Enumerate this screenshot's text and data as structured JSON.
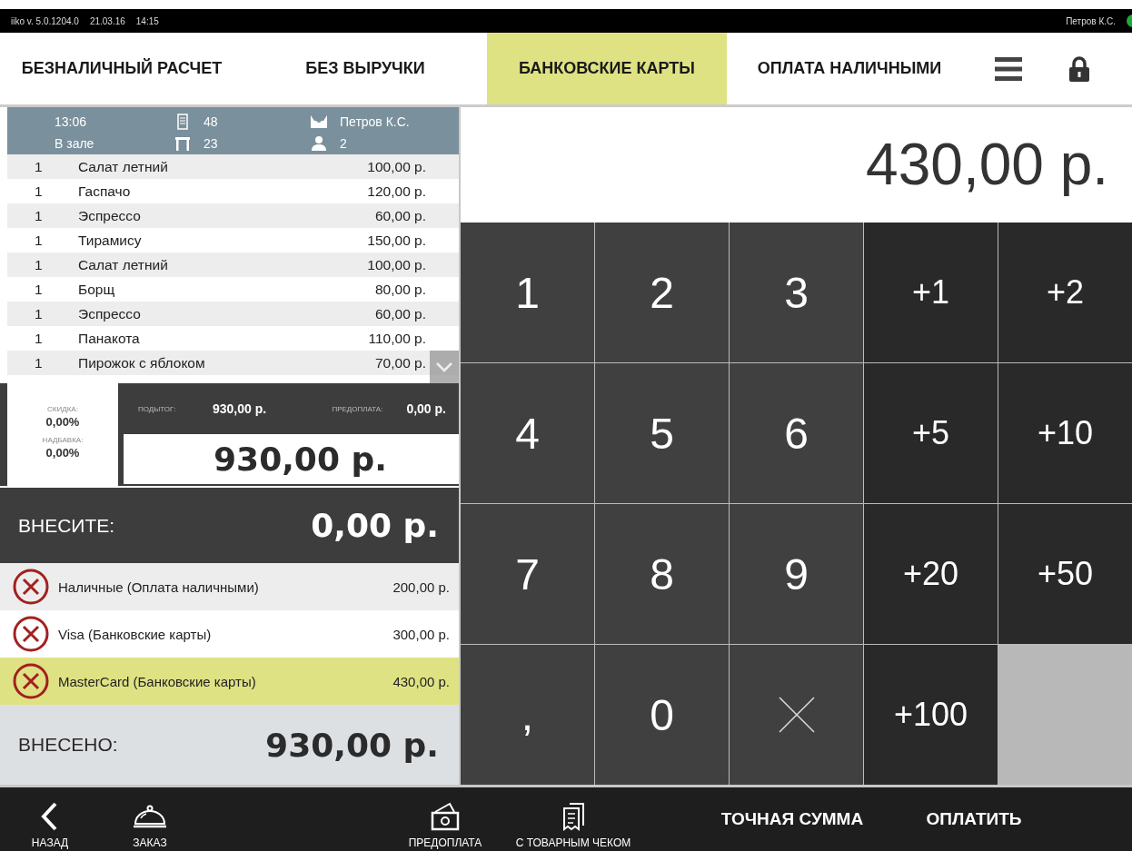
{
  "status_bar": {
    "version": "iiko v. 5.0.1204.0",
    "date": "21.03.16",
    "time": "14:15",
    "user": "Петров К.С."
  },
  "tabs": [
    {
      "label": "БЕЗНАЛИЧНЫЙ РАСЧЕТ",
      "selected": false
    },
    {
      "label": "БЕЗ ВЫРУЧКИ",
      "selected": false
    },
    {
      "label": "БАНКОВСКИЕ КАРТЫ",
      "selected": true
    },
    {
      "label": "ОПЛАТА НАЛИЧНЫМИ",
      "selected": false
    }
  ],
  "order": {
    "time": "13:06",
    "location": "В зале",
    "order_number": "48",
    "table": "23",
    "waiter": "Петров К.С.",
    "guests": "2",
    "items": [
      {
        "qty": "1",
        "name": "Салат летний",
        "price": "100,00 р."
      },
      {
        "qty": "1",
        "name": "Гаспачо",
        "price": "120,00 р."
      },
      {
        "qty": "1",
        "name": "Эспрессо",
        "price": "60,00 р."
      },
      {
        "qty": "1",
        "name": "Тирамису",
        "price": "150,00 р."
      },
      {
        "qty": "1",
        "name": "Салат летний",
        "price": "100,00 р."
      },
      {
        "qty": "1",
        "name": "Борщ",
        "price": "80,00 р."
      },
      {
        "qty": "1",
        "name": "Эспрессо",
        "price": "60,00 р."
      },
      {
        "qty": "1",
        "name": "Панакота",
        "price": "110,00 р."
      },
      {
        "qty": "1",
        "name": "Пирожок с яблоком",
        "price": "70,00 р."
      }
    ]
  },
  "summary": {
    "discount_label": "СКИДКА:",
    "discount": "0,00%",
    "surcharge_label": "НАДБАВКА:",
    "surcharge": "0,00%",
    "subtotal_label": "ПОДЫТОГ:",
    "subtotal": "930,00 р.",
    "prepayment_label": "ПРЕДОПЛАТА:",
    "prepayment": "0,00 р.",
    "total": "930,00 р."
  },
  "due": {
    "label": "ВНЕСИТЕ:",
    "amount": "0,00 р."
  },
  "payments": [
    {
      "name": "Наличные (Оплата наличными)",
      "amount": "200,00 р.",
      "selected": false
    },
    {
      "name": "Visa (Банковские карты)",
      "amount": "300,00 р.",
      "selected": false
    },
    {
      "name": "MasterCard (Банковские карты)",
      "amount": "430,00 р.",
      "selected": true
    }
  ],
  "paid": {
    "label": "ВНЕСЕНО:",
    "amount": "930,00 р."
  },
  "amount_display": "430,00 р.",
  "keypad": [
    {
      "kind": "digit",
      "label": "1"
    },
    {
      "kind": "digit",
      "label": "2"
    },
    {
      "kind": "digit",
      "label": "3"
    },
    {
      "kind": "increment",
      "label": "+1"
    },
    {
      "kind": "increment",
      "label": "+2"
    },
    {
      "kind": "digit",
      "label": "4"
    },
    {
      "kind": "digit",
      "label": "5"
    },
    {
      "kind": "digit",
      "label": "6"
    },
    {
      "kind": "increment",
      "label": "+5"
    },
    {
      "kind": "increment",
      "label": "+10"
    },
    {
      "kind": "digit",
      "label": "7"
    },
    {
      "kind": "digit",
      "label": "8"
    },
    {
      "kind": "digit",
      "label": "9"
    },
    {
      "kind": "increment",
      "label": "+20"
    },
    {
      "kind": "increment",
      "label": "+50"
    },
    {
      "kind": "digit",
      "label": ","
    },
    {
      "kind": "digit",
      "label": "0"
    },
    {
      "kind": "clear"
    },
    {
      "kind": "increment",
      "label": "+100"
    },
    {
      "kind": "empty"
    }
  ],
  "bottom_bar": [
    {
      "kind": "back",
      "label": "НАЗАД"
    },
    {
      "kind": "order",
      "label": "ЗАКАЗ"
    },
    {
      "kind": "spacer"
    },
    {
      "kind": "prepay",
      "label": "ПРЕДОПЛАТА"
    },
    {
      "kind": "receipt",
      "label": "С ТОВАРНЫМ ЧЕКОМ"
    },
    {
      "kind": "action",
      "label": "ТОЧНАЯ СУММА"
    },
    {
      "kind": "action",
      "label": "ОПЛАТИТЬ"
    }
  ]
}
